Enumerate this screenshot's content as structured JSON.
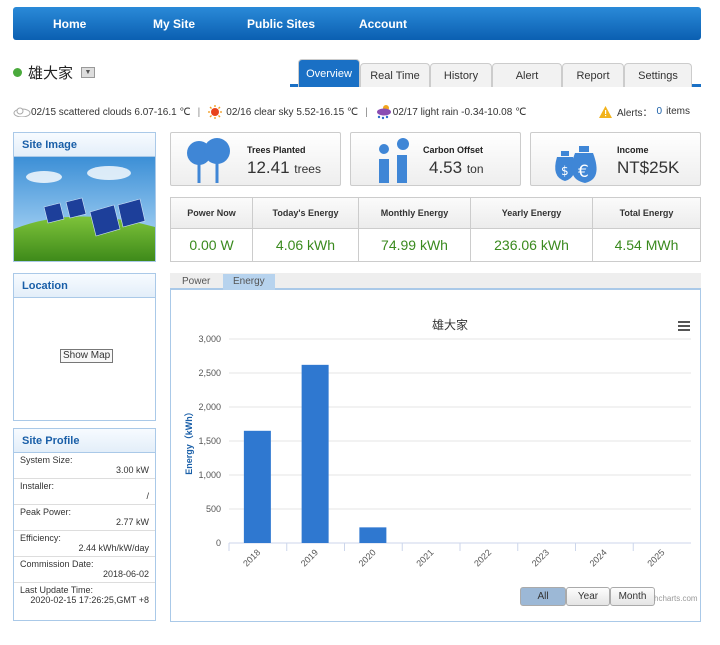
{
  "nav": {
    "items": [
      "Home",
      "My Site",
      "Public Sites",
      "Account"
    ]
  },
  "site": {
    "name": "雄大家",
    "status_color": "#4aaa3c"
  },
  "tabs": [
    "Overview",
    "Real Time",
    "History",
    "Alert",
    "Report",
    "Settings"
  ],
  "active_tab": "Overview",
  "weather": [
    {
      "icon": "cloud-icon",
      "text": "02/15 scattered clouds 6.07-16.1 ℃"
    },
    {
      "icon": "sun-icon",
      "text": "02/16 clear sky 5.52-16.15 ℃"
    },
    {
      "icon": "rain-icon",
      "text": "02/17 light rain -0.34-10.08 ℃"
    }
  ],
  "alerts": {
    "label": "Alerts：",
    "count": "0",
    "suffix": "items"
  },
  "site_image": {
    "title": "Site Image"
  },
  "location": {
    "title": "Location",
    "button": "Show Map"
  },
  "profile": {
    "title": "Site Profile",
    "rows": [
      {
        "label": "System Size:",
        "value": "3.00 kW"
      },
      {
        "label": "Installer:",
        "value": "/"
      },
      {
        "label": "Peak Power:",
        "value": "2.77 kW"
      },
      {
        "label": "Efficiency:",
        "value": "2.44 kWh/kW/day"
      },
      {
        "label": "Commission Date:",
        "value": "2018-06-02"
      },
      {
        "label": "Last Update Time:",
        "value": "2020-02-15 17:26:25,GMT +8"
      }
    ]
  },
  "cards": {
    "trees": {
      "label": "Trees Planted",
      "value": "12.41",
      "unit": "trees"
    },
    "carbon": {
      "label": "Carbon Offset",
      "value": "4.53",
      "unit": "ton"
    },
    "income": {
      "label": "Income",
      "value": "NT$25K"
    }
  },
  "stats": [
    {
      "label": "Power Now",
      "value": "0.00 W"
    },
    {
      "label": "Today's Energy",
      "value": "4.06 kWh"
    },
    {
      "label": "Monthly Energy",
      "value": "74.99 kWh"
    },
    {
      "label": "Yearly Energy",
      "value": "236.06 kWh"
    },
    {
      "label": "Total Energy",
      "value": "4.54 MWh"
    }
  ],
  "chart_tabs": [
    "Power",
    "Energy"
  ],
  "active_chart_tab": "Energy",
  "zoom_buttons": [
    "All",
    "Year",
    "Month"
  ],
  "active_zoom": "All",
  "credit": "hcharts.com",
  "colors": {
    "nav": "#1a70c5",
    "bar": "#2f78d0",
    "value_green": "#3a8a1e"
  },
  "chart_data": {
    "type": "bar",
    "title": "雄大家",
    "ylabel": "Energy（kWh）",
    "categories": [
      "2018",
      "2019",
      "2020",
      "2021",
      "2022",
      "2023",
      "2024",
      "2025"
    ],
    "values": [
      1650,
      2620,
      230,
      0,
      0,
      0,
      0,
      0
    ],
    "yticks": [
      "0",
      "500",
      "1,000",
      "1,500",
      "2,000",
      "2,500",
      "3,000"
    ],
    "ylim": [
      0,
      3000
    ],
    "grid": true
  }
}
